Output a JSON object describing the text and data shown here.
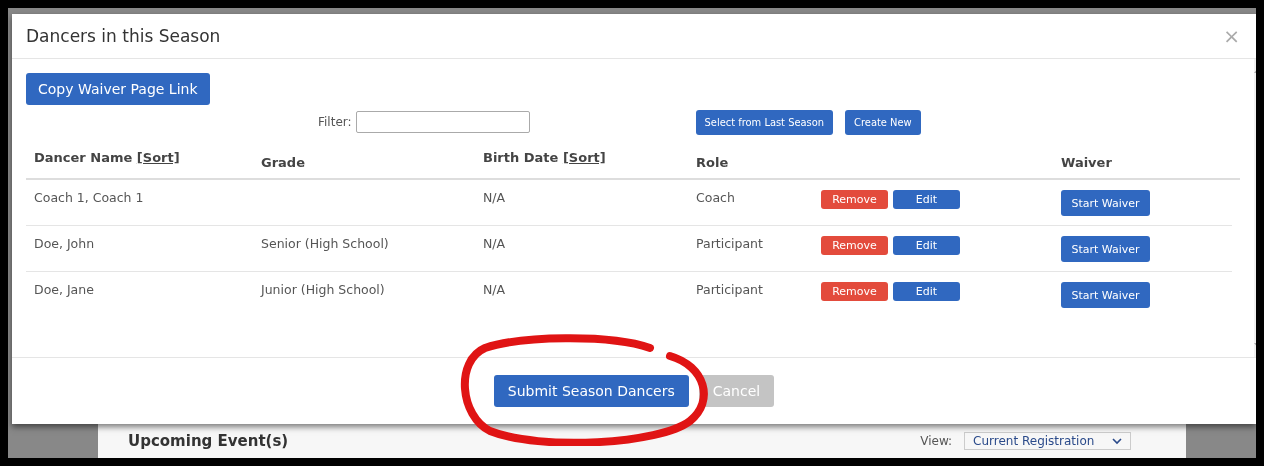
{
  "modal": {
    "title": "Dancers in this Season",
    "close": "×",
    "copy_button": "Copy Waiver Page Link",
    "filter": {
      "label": "Filter:"
    },
    "actions": [
      "Select from Last Season",
      "Create New"
    ],
    "table": {
      "columns": [
        {
          "label": "Dancer Name",
          "sort": "[Sort]"
        },
        {
          "label": "Grade"
        },
        {
          "label": "Birth Date",
          "sort": "[Sort]"
        },
        {
          "label": "Role"
        },
        {
          "label": "Waiver"
        }
      ],
      "rows": [
        {
          "name": "Coach 1, Coach 1",
          "birth_date": "N/A",
          "role": "Coach",
          "remove": "Remove",
          "edit": "Edit",
          "waiver": "Start Waiver"
        },
        {
          "name": "Doe, John",
          "grade": "Senior (High School)",
          "birth_date": "N/A",
          "role": "Participant",
          "remove": "Remove",
          "edit": "Edit",
          "waiver": "Start Waiver"
        },
        {
          "name": "Doe, Jane",
          "grade": "Junior (High School)",
          "birth_date": "N/A",
          "role": "Participant",
          "remove": "Remove",
          "edit": "Edit",
          "waiver": "Start Waiver"
        }
      ]
    },
    "footer": [
      {
        "label": "Submit Season Dancers",
        "disabled": false
      },
      {
        "label": "Cancel",
        "disabled": true
      }
    ]
  },
  "background_page": {
    "heading": "Upcoming Event(s)",
    "view_label": "View:",
    "view_select": "Current Registration"
  }
}
